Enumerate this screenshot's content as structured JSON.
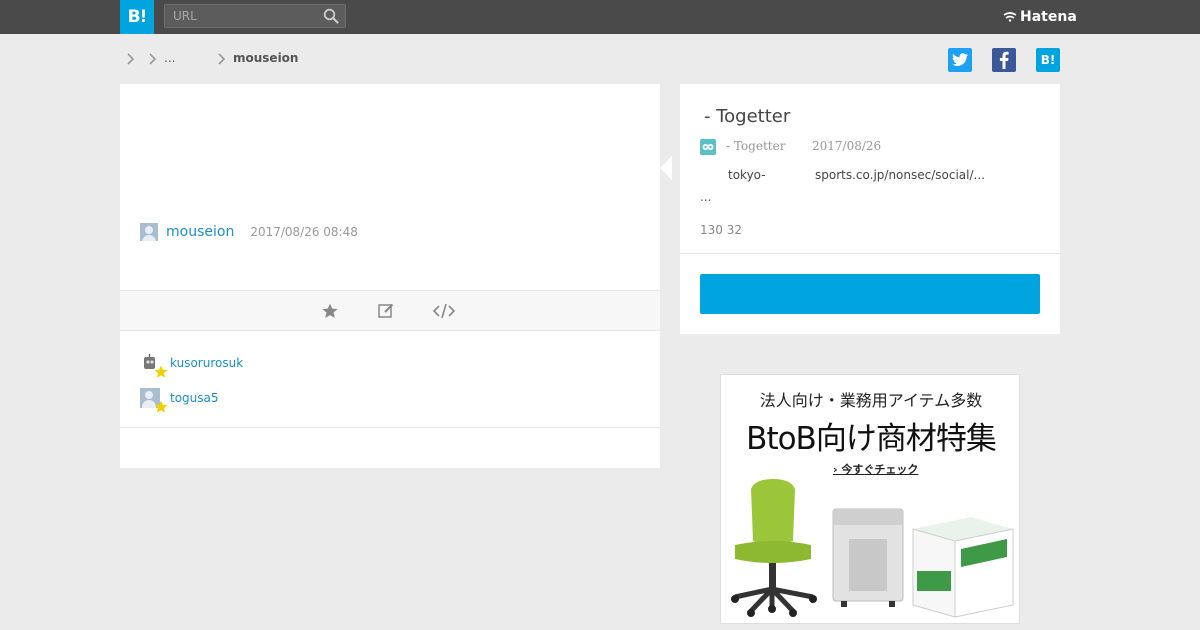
{
  "header": {
    "logo_text": "B!",
    "search_placeholder": "URL",
    "brand": "Hatena"
  },
  "breadcrumb": {
    "item_ellipsis": "...",
    "current": "mouseion"
  },
  "share": {
    "twitter_label": "t",
    "facebook_label": "f",
    "hatena_label": "B!"
  },
  "comment": {
    "user": "mouseion",
    "timestamp": "2017/08/26 08:48"
  },
  "stars": [
    {
      "user": "kusorurosuk"
    },
    {
      "user": "togusa5"
    }
  ],
  "entry": {
    "title": " - Togetter",
    "site_name": "- Togetter",
    "date": "2017/08/26",
    "url_part1": "tokyo-",
    "url_part2": "sports.co.jp/nonsec/social/...",
    "ellipsis": "...",
    "counts": "130 32"
  },
  "ad": {
    "line1": "法人向け・業務用アイテム多数",
    "line2": "BtoB向け商材特集",
    "line3": "今すぐチェック"
  },
  "colors": {
    "accent": "#00a4de",
    "topbar": "#4a4a4a",
    "link": "#1a8fc6",
    "background": "#ebebeb"
  }
}
